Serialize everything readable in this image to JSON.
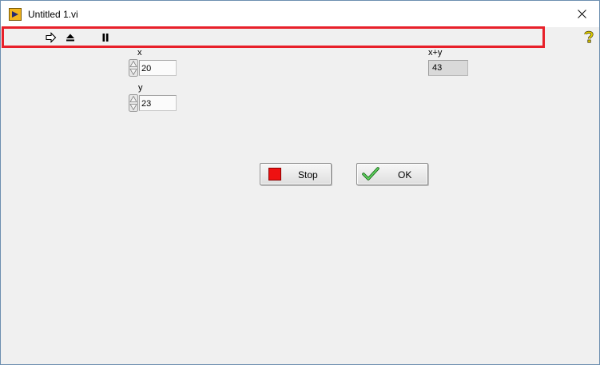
{
  "window": {
    "title": "Untitled 1.vi"
  },
  "icons": {
    "app": "labview-vi-icon",
    "close": "close-icon",
    "run": "run-arrow-icon",
    "abort": "abort-execution-icon",
    "pause": "pause-icon",
    "help": "context-help-icon"
  },
  "controls": {
    "x": {
      "label": "x",
      "value": "20"
    },
    "y": {
      "label": "y",
      "value": "23"
    }
  },
  "indicators": {
    "sum": {
      "label": "x+y",
      "value": "43"
    }
  },
  "buttons": {
    "stop": {
      "label": "Stop",
      "color": "#ee1111"
    },
    "ok": {
      "label": "OK",
      "color": "#2fa52f"
    }
  },
  "colors": {
    "highlight_border": "#e8202a",
    "help": "#d8c600"
  }
}
